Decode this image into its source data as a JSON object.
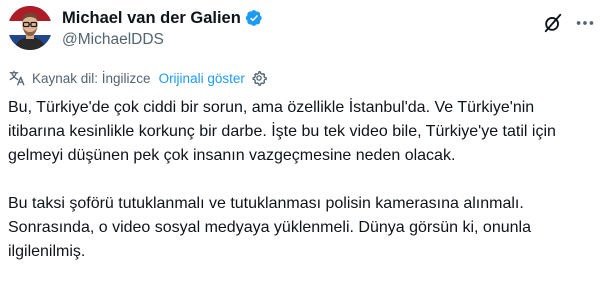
{
  "author": {
    "display_name": "Michael van der Galien",
    "handle": "@MichaelDDS",
    "verified": true
  },
  "translation": {
    "source_label": "Kaynak dil: İngilizce",
    "show_original_label": "Orijinali göster"
  },
  "tweet": {
    "paragraphs": [
      "Bu, Türkiye'de çok ciddi bir sorun, ama özellikle İstanbul'da. Ve Türkiye'nin itibarına kesinlikle korkunç bir darbe. İşte bu tek video bile, Türkiye'ye tatil için gelmeyi düşünen pek çok insanın vazgeçmesine neden olacak.",
      "Bu taksi şoförü tutuklanmalı ve tutuklanması polisin kamerasına alınmalı. Sonrasında, o video sosyal medyaya yüklenmeli. Dünya görsün ki, onunla ilgilenilmiş."
    ]
  },
  "icons": {
    "avatar": "avatar",
    "verified": "verified-badge-icon",
    "grok": "grok-icon",
    "more": "more-icon",
    "translate": "translate-icon",
    "settings": "gear-icon"
  },
  "colors": {
    "accent": "#1d9bf0",
    "text_primary": "#0f1419",
    "text_secondary": "#536471"
  }
}
